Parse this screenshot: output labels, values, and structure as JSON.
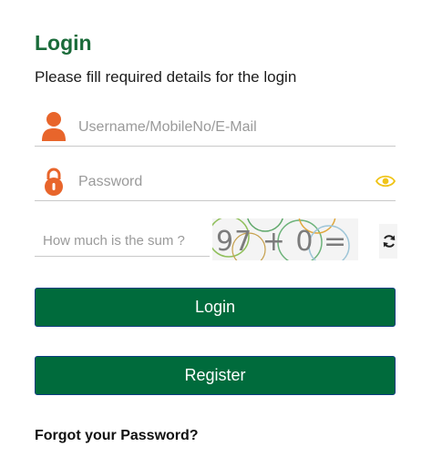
{
  "header": {
    "title": "Login",
    "subtitle": "Please fill required details for the login"
  },
  "fields": {
    "username": {
      "value": "",
      "placeholder": "Username/MobileNo/E-Mail",
      "icon": "user-icon"
    },
    "password": {
      "value": "",
      "placeholder": "Password",
      "icon": "lock-icon",
      "toggle_icon": "eye-icon"
    }
  },
  "captcha": {
    "input_value": "",
    "placeholder": "How much is the sum ?",
    "image_text": "97 + 0 = ?",
    "refresh_icon": "refresh-icon"
  },
  "buttons": {
    "login_label": "Login",
    "register_label": "Register"
  },
  "links": {
    "forgot_password": "Forgot your Password?"
  },
  "colors": {
    "brand_green": "#006b3c",
    "title_green": "#1a6b3a",
    "icon_orange": "#e8652b",
    "eye_yellow": "#f0c419"
  }
}
